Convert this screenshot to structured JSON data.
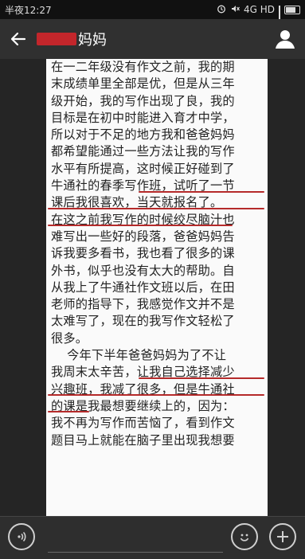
{
  "status_bar": {
    "time": "半夜12:27",
    "network": "4G HD",
    "icons": [
      "alarm-icon",
      "silent-icon",
      "signal-icon",
      "battery-icon"
    ]
  },
  "header": {
    "title": "妈妈",
    "icons": [
      "back-arrow-icon",
      "profile-icon"
    ]
  },
  "article": {
    "lines": [
      "在一二年级没有作文之前，我的期",
      "末成绩单里全部是优，但是从三年",
      "级开始，我的写作出现了良，我的",
      "目标是在初中时能进入育才中学，",
      "所以对于不足的地方我和爸爸妈妈",
      "都希望能通过一些方法让我的写作",
      "水平有所提高，这时候正好碰到了",
      "牛通社的春季写作班，试听了一节",
      "课后我很喜欢，当天就报名了。",
      "在这之前我写作的时候绞尽脑汁也",
      "难写出一些好的段落，爸爸妈妈告",
      "诉我要多看书，我也看了很多的课",
      "外书，似乎也没有太大的帮助。自",
      "从我上了牛通社作文班以后，在田",
      "老师的指导下，我感觉作文并不是",
      "太难写了，现在的我写作文轻松了",
      "很多。",
      "    今年下半年爸爸妈妈为了不让",
      "我周末太辛苦，让我自己选择减少",
      "兴趣班，我减了很多，但是牛通社",
      "的课是我最想要继续上的，因为：",
      "我不再为写作而苦恼了，看到作文",
      "题目马上就能在脑子里出现我想要"
    ]
  },
  "bottom_bar": {
    "icons": [
      "voice-icon",
      "emoji-icon",
      "add-icon"
    ]
  }
}
